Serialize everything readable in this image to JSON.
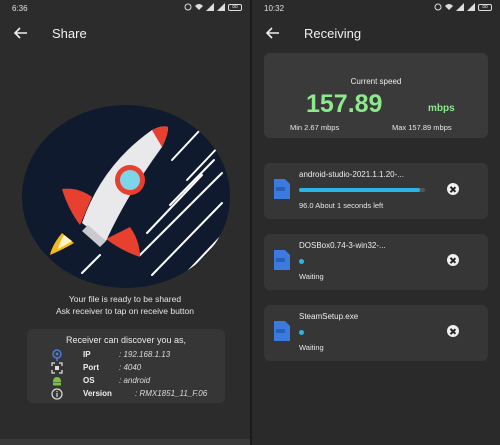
{
  "left": {
    "status_time": "6:36",
    "battery": "88",
    "title": "Share",
    "ready_line1": "Your file is ready to be shared",
    "ready_line2": "Ask receiver to tap on receive button",
    "discover_title": "Receiver can discover you as,",
    "info": [
      {
        "icon": "location-pin-icon",
        "label": "IP",
        "value": ": 192.168.1.13"
      },
      {
        "icon": "scan-frame-icon",
        "label": "Port",
        "value": ": 4040"
      },
      {
        "icon": "android-icon",
        "label": "OS",
        "value": ": android"
      },
      {
        "icon": "info-icon",
        "label": "Version",
        "value": ": RMX1851_11_F.06"
      }
    ]
  },
  "right": {
    "status_time": "10:32",
    "battery": "88",
    "title": "Receiving",
    "speed": {
      "label": "Current speed",
      "value": "157.89",
      "unit": "mbps",
      "min": "Min 2.67 mbps",
      "max": "Max 157.89  mbps"
    },
    "files": [
      {
        "name": "android-studio-2021.1.1.20-...",
        "status": "96.0    About 1 seconds left",
        "progress_percent": 96
      },
      {
        "name": "DOSBox0.74-3-win32-...",
        "status": "Waiting"
      },
      {
        "name": "SteamSetup.exe",
        "status": "Waiting"
      }
    ]
  },
  "colors": {
    "accent_green": "#8ee88c",
    "progress_blue": "#2bb5e6",
    "file_icon_blue": "#3b7be0",
    "rocket_red": "#e8402e",
    "circle_navy": "#0f1a2e"
  }
}
